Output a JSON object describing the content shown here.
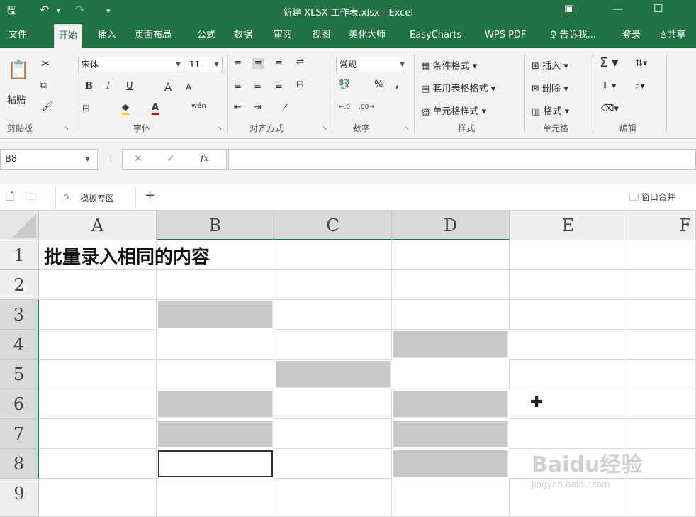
{
  "titlebar": {
    "title": "新建 XLSX 工作表.xlsx - Excel",
    "save_icon": "floppy-save-icon",
    "undo_icon": "undo-icon",
    "redo_icon": "redo-icon"
  },
  "tabs": [
    "文件",
    "开始",
    "插入",
    "页面布局",
    "公式",
    "数据",
    "审阅",
    "视图",
    "美化大师",
    "EasyCharts",
    "WPS PDF"
  ],
  "active_tab": "开始",
  "tellme": "告诉我...",
  "login": "登录",
  "share": "共享",
  "ribbon": {
    "clipboard": {
      "paste": "粘贴",
      "label": "剪贴板"
    },
    "font": {
      "name": "宋体",
      "size": "11",
      "label": "字体",
      "bold": "B",
      "italic": "I",
      "underline": "U",
      "grow": "A",
      "shrink": "A",
      "phonetic": "wén"
    },
    "align": {
      "label": "对齐方式"
    },
    "number": {
      "format": "常规",
      "label": "数字",
      "percent": "%",
      "comma": ","
    },
    "styles": {
      "cond": "条件格式",
      "table": "套用表格格式",
      "cell": "单元格样式",
      "label": "样式"
    },
    "cells": {
      "insert": "插入",
      "delete": "删除",
      "format": "格式",
      "label": "单元格"
    },
    "edit": {
      "label": "编辑",
      "sigma": "Σ"
    }
  },
  "formula_bar": {
    "namebox": "B8",
    "fx": "fx",
    "cancel": "✕",
    "enter": "✓",
    "formula": ""
  },
  "docbar": {
    "template_tab": "模板专区",
    "add": "+",
    "window_merge": "窗口合并"
  },
  "columns": [
    "A",
    "B",
    "C",
    "D",
    "E",
    "F"
  ],
  "rows": [
    "1",
    "2",
    "3",
    "4",
    "5",
    "6",
    "7",
    "8",
    "9"
  ],
  "cell_A1": "批量录入相同的内容",
  "selected_cells": [
    "B3",
    "D4",
    "C5",
    "B6",
    "D6",
    "B7",
    "D7",
    "D8"
  ],
  "active_cell": "B8",
  "watermark": {
    "logo": "Baidu经验",
    "url": "jingyan.baidu.com"
  },
  "colors": {
    "excel_green": "#217346",
    "selection_gray": "#c8c8c8"
  }
}
